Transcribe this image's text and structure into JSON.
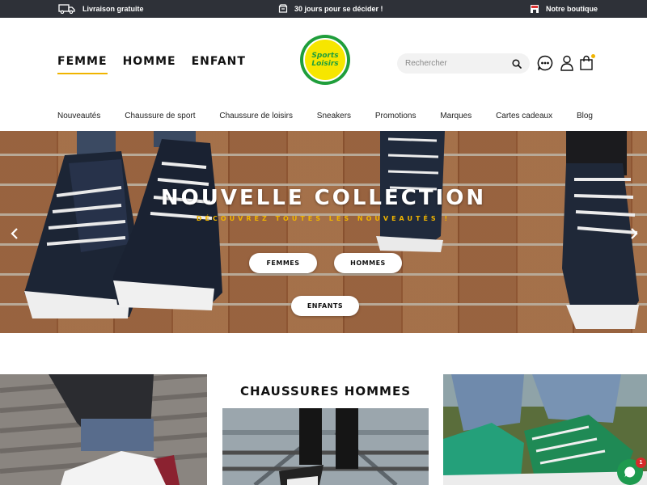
{
  "topbar": {
    "shipping": "Livraison gratuite",
    "returns": "30 jours pour se décider !",
    "store": "Notre boutique"
  },
  "main_nav": [
    "FEMME",
    "HOMME",
    "ENFANT"
  ],
  "logo": {
    "line1": "Sports",
    "line2": "Loisirs"
  },
  "search": {
    "placeholder": "Rechercher"
  },
  "header_icons": [
    "chat-icon",
    "user-icon",
    "shopping-bag-icon"
  ],
  "categories": [
    "Nouveautés",
    "Chaussure de sport",
    "Chaussure de loisirs",
    "Sneakers",
    "Promotions",
    "Marques",
    "Cartes cadeaux",
    "Blog"
  ],
  "hero": {
    "title": "NOUVELLE COLLECTION",
    "subtitle": "DÉCOUVREZ TOUTES LES NOUVEAUTÉS !",
    "buttons": {
      "women": "FEMMES",
      "men": "HOMMES",
      "kids": "ENFANTS"
    }
  },
  "section": {
    "heading": "CHAUSSURES HOMMES"
  },
  "chat": {
    "badge": "1"
  },
  "colors": {
    "topbar": "#2e3138",
    "accent": "#f0b400",
    "logo_green": "#1f9e3b",
    "logo_yellow": "#f6e600",
    "chat_green": "#1e9a4f"
  }
}
